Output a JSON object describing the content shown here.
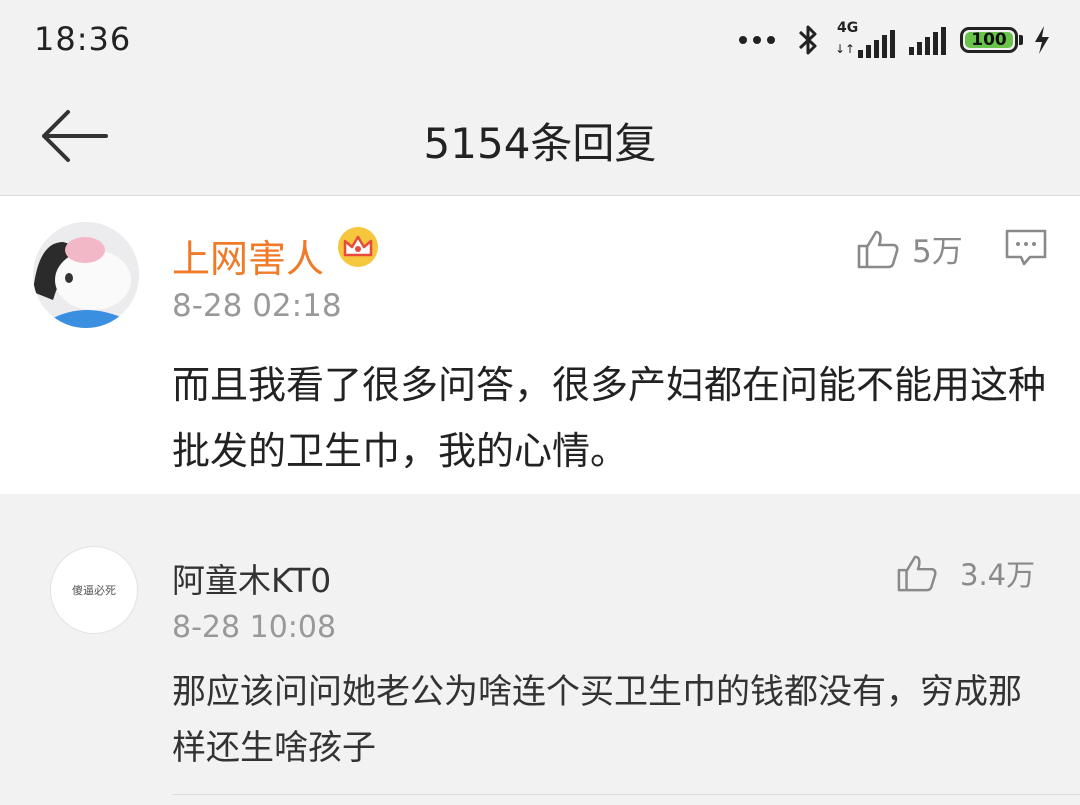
{
  "status_bar": {
    "time": "18:36",
    "network_label": "4G",
    "network_arrows": "↓↑",
    "battery": "100",
    "icons": [
      "more-dots-icon",
      "bluetooth-icon",
      "signal-icon",
      "signal-icon",
      "battery-icon",
      "charging-bolt-icon"
    ],
    "battery_color": "#6ac34a"
  },
  "header": {
    "title": "5154条回复",
    "back_icon": "back-arrow-icon"
  },
  "main_comment": {
    "username": "上网害人",
    "username_color": "#f07a28",
    "badge_icon": "crown-icon",
    "timestamp": "8-28 02:18",
    "like_count": "5万",
    "text": "而且我看了很多问答，很多产妇都在问能不能用这种批发的卫生巾，我的心情。"
  },
  "replies": [
    {
      "username": "阿童木KT0",
      "avatar_text": "傻逼必死",
      "timestamp": "8-28 10:08",
      "like_count": "3.4万",
      "text": "那应该问问她老公为啥连个买卫生巾的钱都没有，穷成那样还生啥孩子"
    }
  ]
}
